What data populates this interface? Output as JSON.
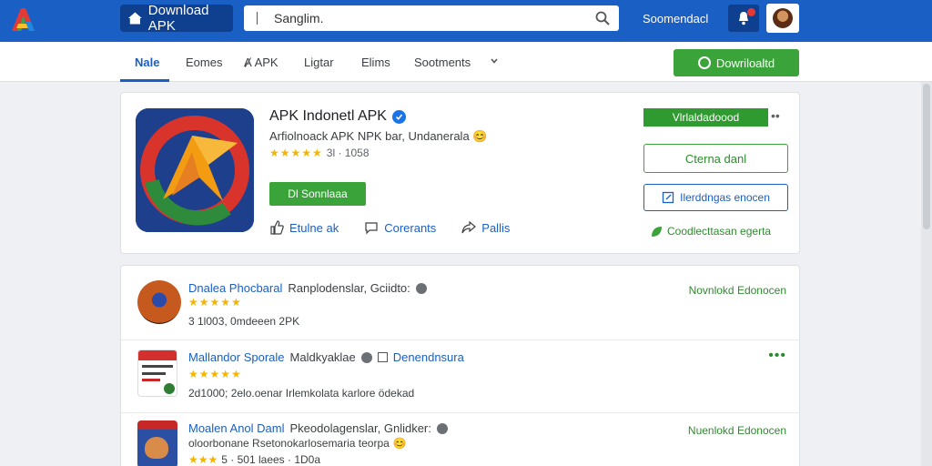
{
  "header": {
    "brand_button": "Download APK",
    "search_placeholder": "Sanglim.",
    "account_link": "Soomendacl",
    "colors": {
      "bar": "#1a5fc4",
      "accent_green": "#3aa33a"
    }
  },
  "nav": {
    "tabs": [
      "Nale",
      "Eomes",
      "APK",
      "Ligtar",
      "Elims",
      "Sootments"
    ],
    "active_tab": "Nale",
    "download_button": "Dowriloaltd"
  },
  "app": {
    "title": "APK Indonetl APK",
    "subtitle": "Arfiolnoack APK NPK bar, Undanerala",
    "rating_text": "3l · 1058",
    "install_button": "Dl Sonnlaaa",
    "actions": [
      "Etulne ak",
      "Corerants",
      "Pallis"
    ],
    "right": {
      "top_button": "Vlrlaldadoood",
      "outline_green": "Cterna danl",
      "outline_blue": "Ilerddngas enocen",
      "link": "Coodlecttasan egerta"
    }
  },
  "list": [
    {
      "name": "Dnalea Phocbaral",
      "tag": "Ranplodenslar, Gciidto:",
      "stars": "★★★★★",
      "meta": "3 1l003, 0mdeeen 2PK",
      "right": "Novnlokd Edonocen"
    },
    {
      "name": "Mallandor Sporale",
      "tag": "Maldkyaklae",
      "tag2": "Denendnsura",
      "stars": "★★★★★",
      "meta": "2d1000; 2elo.oenar Irlemkolata karlore ödekad",
      "right": "•••"
    },
    {
      "name": "Moalen Anol Daml",
      "tag": "Pkeodolagenslar, Gnlidker:",
      "sub": "oloorbonane Rsetonokarlosemaria teorpa",
      "stars": "★★★",
      "meta": "5 · 501 laees · 1D0a",
      "right": "Nuenlokd Edonocen"
    }
  ]
}
